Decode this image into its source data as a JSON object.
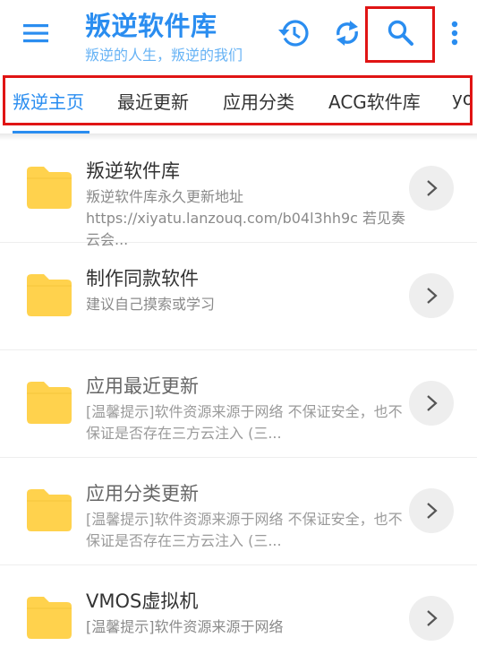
{
  "app": {
    "title": "叛逆软件库",
    "subtitle": "叛逆的人生，叛逆的我们"
  },
  "colors": {
    "accent": "#2a8df0",
    "highlight": "#e01414",
    "folder": "#ffd24d"
  },
  "toolbar": {
    "menu_icon": "hamburger-menu-icon",
    "history_icon": "history-icon",
    "refresh_icon": "refresh-icon",
    "search_icon": "search-icon",
    "more_icon": "more-vertical-icon"
  },
  "tabs": [
    {
      "label": "叛逆主页",
      "active": true
    },
    {
      "label": "最近更新",
      "active": false
    },
    {
      "label": "应用分类",
      "active": false
    },
    {
      "label": "ACG软件库",
      "active": false
    },
    {
      "label": "yo",
      "active": false
    }
  ],
  "items": [
    {
      "title": "叛逆软件库",
      "desc": "叛逆软件库永久更新地址 https://xiyatu.lanzouq.com/b04l3hh9c 若见奏云会...",
      "icon": "folder-icon"
    },
    {
      "title": "制作同款软件",
      "desc": "建议自己摸索或学习",
      "icon": "folder-icon"
    },
    {
      "title": "应用最近更新",
      "desc": "[温馨提示]软件资源来源于网络 不保证安全，也不保证是否存在三方云注入 (三...",
      "icon": "folder-icon"
    },
    {
      "title": "应用分类更新",
      "desc": "[温馨提示]软件资源来源于网络 不保证安全，也不保证是否存在三方云注入 (三...",
      "icon": "folder-icon"
    },
    {
      "title": "VMOS虚拟机",
      "desc": "[温馨提示]软件资源来源于网络",
      "icon": "folder-icon"
    }
  ]
}
